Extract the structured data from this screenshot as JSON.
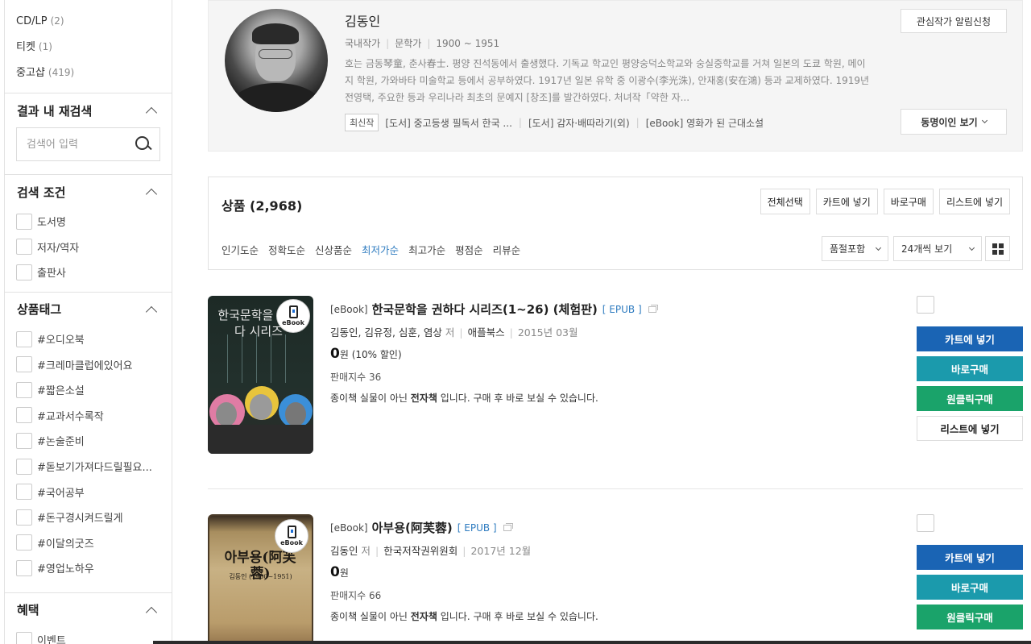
{
  "sidebar": {
    "categories": [
      {
        "label": "CD/LP",
        "count": "(2)"
      },
      {
        "label": "티켓",
        "count": "(1)"
      },
      {
        "label": "중고샵",
        "count": "(419)"
      }
    ],
    "research": {
      "title": "결과 내 재검색",
      "placeholder": "검색어 입력"
    },
    "conditions": {
      "title": "검색 조건",
      "items": [
        "도서명",
        "저자/역자",
        "출판사"
      ]
    },
    "tags": {
      "title": "상품태그",
      "items": [
        "#오디오북",
        "#크레마클럽에있어요",
        "#짧은소설",
        "#교과서수록작",
        "#논술준비",
        "#돋보기가져다드릴필요...",
        "#국어공부",
        "#돈구경시켜드릴게",
        "#이달의굿즈",
        "#영업노하우"
      ]
    },
    "benefits": {
      "title": "혜택",
      "items": [
        "이벤트"
      ]
    }
  },
  "author": {
    "name": "김동인",
    "meta": [
      "국내작가",
      "문학가",
      "1900 ~ 1951"
    ],
    "description": "호는 금동琴童, 춘사春士. 평양 진석동에서 출생했다. 기독교 학교인 평양숭덕소학교와 숭실중학교를 거쳐 일본의 도쿄 학원, 메이지 학원, 가와바타 미술학교 등에서 공부하였다. 1917년 일본 유학 중 이광수(李光洙), 안재홍(安在鴻) 등과 교제하였다. 1919년 전영택, 주요한 등과 우리나라 최초의 문예지 [창조]를 발간하였다. 처녀작「약한 자...",
    "recent_tag": "최신작",
    "recent_works": [
      "[도서] 중고등생 필독서 한국 ...",
      "[도서] 감자·배따라기(외)",
      "[eBook] 영화가 된 근대소설"
    ],
    "follow_button": "관심작가 알림신청",
    "same_name_button": "동명이인 보기"
  },
  "products": {
    "title": "상품",
    "count": "(2,968)",
    "buttons": [
      "전체선택",
      "카트에 넣기",
      "바로구매",
      "리스트에 넣기"
    ],
    "sorts": [
      "인기도순",
      "정확도순",
      "신상품순",
      "최저가순",
      "최고가순",
      "평점순",
      "리뷰순"
    ],
    "active_sort": "최저가순",
    "filter_select": "품절포함",
    "view_select": "24개씩 보기"
  },
  "items": [
    {
      "category": "[eBook]",
      "title": "한국문학을 권하다 시리즈(1~26) (체험판)",
      "format": "[ EPUB ]",
      "authors": "김동인, 김유정, 심훈, 염상",
      "role": "저",
      "publisher": "애플북스",
      "date": "2015년 03월",
      "price": "0",
      "price_unit": "원",
      "discount": "(10% 할인)",
      "sales": "판매지수 36",
      "desc_pre": "종이책 실물이 아닌 ",
      "desc_bold": "전자책",
      "desc_post": " 입니다. 구매 후 바로 보실 수 있습니다.",
      "cover_title": "한국문학을 권하다 시리즈",
      "badge": "eBook"
    },
    {
      "category": "[eBook]",
      "title": "아부용(阿芙蓉)",
      "format": "[ EPUB ]",
      "authors": "김동인",
      "role": "저",
      "publisher": "한국저작권위원회",
      "date": "2017년 12월",
      "price": "0",
      "price_unit": "원",
      "discount": "",
      "sales": "판매지수 66",
      "desc_pre": "종이책 실물이 아닌 ",
      "desc_bold": "전자책",
      "desc_post": " 입니다. 구매 후 바로 보실 수 있습니다.",
      "cover_title": "아부용(阿芙蓉)",
      "cover_sub": "김동인 (1900~1951)",
      "badge": "eBook"
    }
  ],
  "item_actions": [
    "카트에 넣기",
    "바로구매",
    "원클릭구매",
    "리스트에 넣기"
  ],
  "colors": {
    "accent_blue": "#1a64b4",
    "teal": "#1b9aac",
    "green": "#1aa36a",
    "link": "#2f7cc0"
  }
}
